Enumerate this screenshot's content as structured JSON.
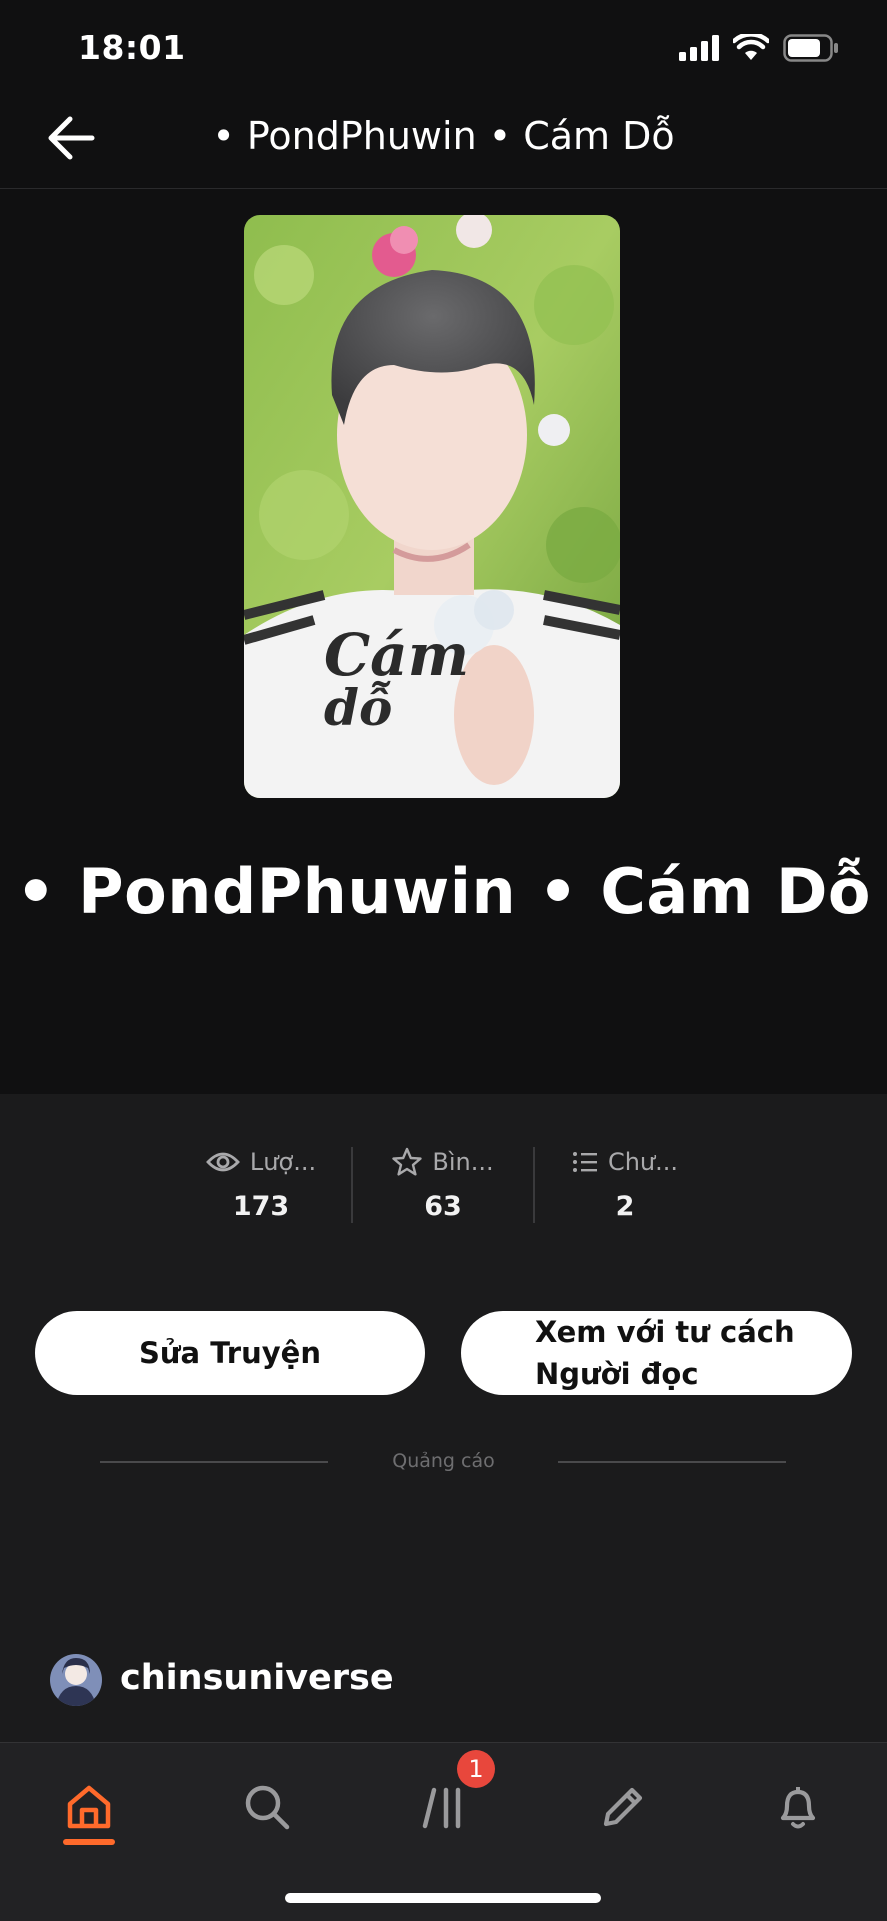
{
  "status": {
    "time": "18:01"
  },
  "nav": {
    "title": "• PondPhuwin • Cám Dỗ"
  },
  "cover": {
    "art_text_1": "Cám",
    "art_text_2": "dỗ"
  },
  "story": {
    "title": "• PondPhuwin • Cám Dỗ"
  },
  "stats": [
    {
      "icon": "eye-icon",
      "label": "Lượ...",
      "value": "173"
    },
    {
      "icon": "star-icon",
      "label": "Bìn...",
      "value": "63"
    },
    {
      "icon": "list-icon",
      "label": "Chư...",
      "value": "2"
    }
  ],
  "buttons": {
    "edit": "Sửa Truyện",
    "reader_line1": "Xem với tư cách",
    "reader_line2": "Người đọc"
  },
  "ad": {
    "label": "Quảng cáo"
  },
  "author": {
    "name": "chinsuniverse"
  },
  "tabbar": {
    "items": [
      "home-icon",
      "search-icon",
      "library-icon",
      "write-icon",
      "bell-icon"
    ],
    "active": "home-icon",
    "library_badge": "1",
    "accent": "#ff6a2b"
  },
  "colors": {
    "badge": "#e8473c",
    "background": "#1b1b1c"
  }
}
